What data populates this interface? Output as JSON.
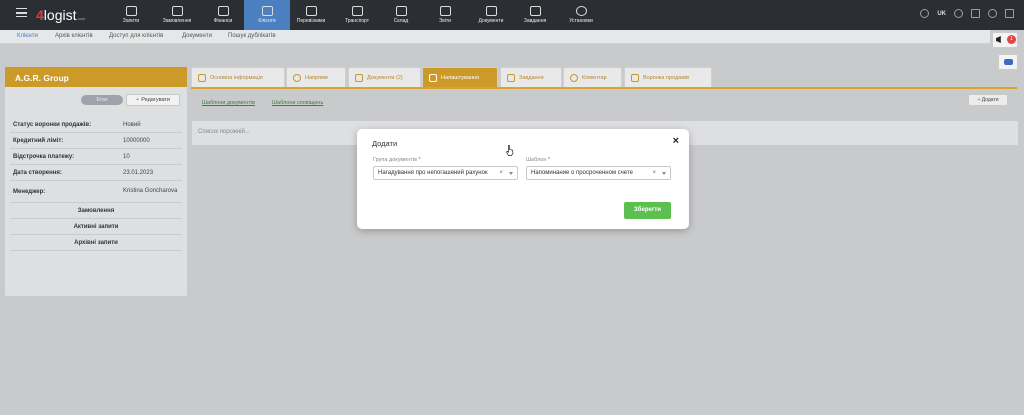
{
  "app": {
    "logo_num": "4",
    "logo_text": "logist",
    "logo_small": ".com"
  },
  "nav": [
    {
      "label": "Запити"
    },
    {
      "label": "Замовлення"
    },
    {
      "label": "Фінанси"
    },
    {
      "label": "Клієнти"
    },
    {
      "label": "Перевізники"
    },
    {
      "label": "Транспорт"
    },
    {
      "label": "Склад"
    },
    {
      "label": "Звіти"
    },
    {
      "label": "Документи"
    },
    {
      "label": "Завдання"
    },
    {
      "label": "Установки"
    }
  ],
  "topright": {
    "lang": "UK"
  },
  "subnav": [
    {
      "label": "Клієнти"
    },
    {
      "label": "Архів клієнтів"
    },
    {
      "label": "Доступ для клієнтів"
    },
    {
      "label": "Документи"
    },
    {
      "label": "Пошук дублікатів"
    }
  ],
  "notif_count": "1",
  "client": {
    "name": "A.G.R. Group",
    "status_button": "Етап",
    "edit_button": "Редагувати",
    "fields": [
      {
        "k": "Статус воронки продажів:",
        "v": "Новий"
      },
      {
        "k": "Кредитний ліміт:",
        "v": "10000000"
      },
      {
        "k": "Відстрочка платежу:",
        "v": "10"
      },
      {
        "k": "Дата створення:",
        "v": "23.01.2023"
      },
      {
        "k": "Менеджер:",
        "v": "Kristina Goncharova"
      }
    ],
    "groups": [
      "Замовлення",
      "Активні запити",
      "Архівні запити"
    ]
  },
  "tabs": [
    {
      "label": "Основна інформація"
    },
    {
      "label": "Напрями"
    },
    {
      "label": "Документи  (2)"
    },
    {
      "label": "Налаштування"
    },
    {
      "label": "Завдання"
    },
    {
      "label": "Коментар"
    },
    {
      "label": "Воронка продажів"
    }
  ],
  "subtabs": [
    "Шаблони документів",
    "Шаблони сповіщень"
  ],
  "add_button": "Додати",
  "list_empty": "Список порожній...",
  "modal": {
    "title": "Додати",
    "group_label": "Група документів",
    "group_value": "Нагадування про непогашений рахунок",
    "template_label": "Шаблон",
    "template_value": "Напоминание о просроченном счете",
    "required_mark": "*",
    "clear": "×",
    "close": "×",
    "save": "Зберегти"
  }
}
